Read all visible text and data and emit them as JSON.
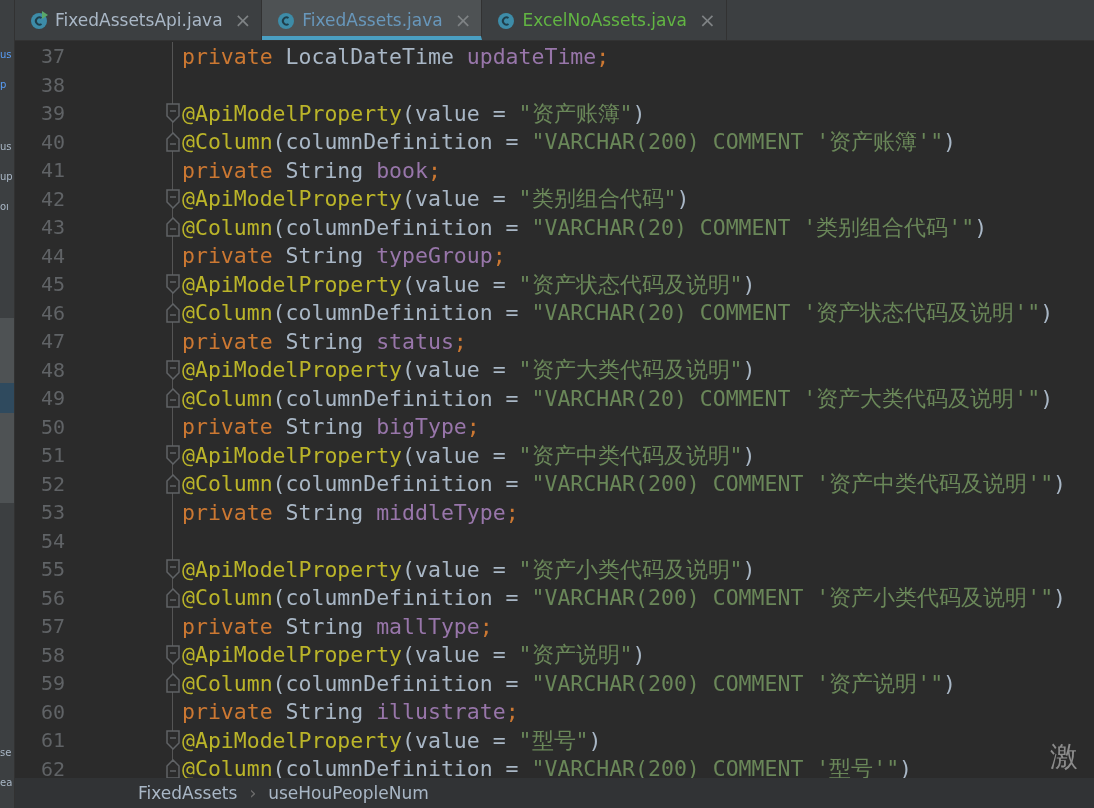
{
  "side_panel": {
    "fragments": [
      {
        "text": "us",
        "kind": "link"
      },
      {
        "text": "p",
        "kind": "link"
      },
      {
        "text": "us",
        "kind": "plain"
      },
      {
        "text": "up",
        "kind": "plain"
      },
      {
        "text": "oı",
        "kind": "plain"
      }
    ],
    "bottom_fragments": [
      {
        "text": "se"
      },
      {
        "text": "ea"
      }
    ]
  },
  "tabs": [
    {
      "label": "FixedAssetsApi.java",
      "close": "×",
      "selected": false,
      "color": "#a9b7c6",
      "runnable": true
    },
    {
      "label": "FixedAssets.java",
      "close": "×",
      "selected": true,
      "color": "#6897bb",
      "runnable": false
    },
    {
      "label": "ExcelNoAssets.java",
      "close": "×",
      "selected": false,
      "color": "#62b543",
      "runnable": false
    }
  ],
  "lines": [
    {
      "number": "37",
      "tokens": [
        {
          "kind": "kw",
          "text": "private "
        },
        {
          "kind": "plain",
          "text": "LocalDateTime "
        },
        {
          "kind": "field",
          "text": "updateTime"
        },
        {
          "kind": "kw",
          "text": ";"
        }
      ]
    },
    {
      "number": "38"
    },
    {
      "number": "39",
      "fold_start": true,
      "tokens": [
        {
          "kind": "ann",
          "text": "@ApiModelProperty"
        },
        {
          "kind": "plain",
          "text": "(value = "
        },
        {
          "kind": "str",
          "text": "\"资产账簿\""
        },
        {
          "kind": "plain",
          "text": ")"
        }
      ]
    },
    {
      "number": "40",
      "fold_end": true,
      "tokens": [
        {
          "kind": "ann",
          "text": "@Column"
        },
        {
          "kind": "plain",
          "text": "(columnDefinition = "
        },
        {
          "kind": "str",
          "text": "\"VARCHAR(200) COMMENT '资产账簿'\""
        },
        {
          "kind": "plain",
          "text": ")"
        }
      ]
    },
    {
      "number": "41",
      "tokens": [
        {
          "kind": "kw",
          "text": "private "
        },
        {
          "kind": "plain",
          "text": "String "
        },
        {
          "kind": "field",
          "text": "book"
        },
        {
          "kind": "kw",
          "text": ";"
        }
      ]
    },
    {
      "number": "42",
      "fold_start": true,
      "tokens": [
        {
          "kind": "ann",
          "text": "@ApiModelProperty"
        },
        {
          "kind": "plain",
          "text": "(value = "
        },
        {
          "kind": "str",
          "text": "\"类别组合代码\""
        },
        {
          "kind": "plain",
          "text": ")"
        }
      ]
    },
    {
      "number": "43",
      "fold_end": true,
      "tokens": [
        {
          "kind": "ann",
          "text": "@Column"
        },
        {
          "kind": "plain",
          "text": "(columnDefinition = "
        },
        {
          "kind": "str",
          "text": "\"VARCHAR(20) COMMENT '类别组合代码'\""
        },
        {
          "kind": "plain",
          "text": ")"
        }
      ]
    },
    {
      "number": "44",
      "tokens": [
        {
          "kind": "kw",
          "text": "private "
        },
        {
          "kind": "plain",
          "text": "String "
        },
        {
          "kind": "field",
          "text": "typeGroup"
        },
        {
          "kind": "kw",
          "text": ";"
        }
      ]
    },
    {
      "number": "45",
      "fold_start": true,
      "tokens": [
        {
          "kind": "ann",
          "text": "@ApiModelProperty"
        },
        {
          "kind": "plain",
          "text": "(value = "
        },
        {
          "kind": "str",
          "text": "\"资产状态代码及说明\""
        },
        {
          "kind": "plain",
          "text": ")"
        }
      ]
    },
    {
      "number": "46",
      "fold_end": true,
      "tokens": [
        {
          "kind": "ann",
          "text": "@Column"
        },
        {
          "kind": "plain",
          "text": "(columnDefinition = "
        },
        {
          "kind": "str",
          "text": "\"VARCHAR(20) COMMENT '资产状态代码及说明'\""
        },
        {
          "kind": "plain",
          "text": ")"
        }
      ]
    },
    {
      "number": "47",
      "tokens": [
        {
          "kind": "kw",
          "text": "private "
        },
        {
          "kind": "plain",
          "text": "String "
        },
        {
          "kind": "field",
          "text": "status"
        },
        {
          "kind": "kw",
          "text": ";"
        }
      ]
    },
    {
      "number": "48",
      "fold_start": true,
      "tokens": [
        {
          "kind": "ann",
          "text": "@ApiModelProperty"
        },
        {
          "kind": "plain",
          "text": "(value = "
        },
        {
          "kind": "str",
          "text": "\"资产大类代码及说明\""
        },
        {
          "kind": "plain",
          "text": ")"
        }
      ]
    },
    {
      "number": "49",
      "fold_end": true,
      "tokens": [
        {
          "kind": "ann",
          "text": "@Column"
        },
        {
          "kind": "plain",
          "text": "(columnDefinition = "
        },
        {
          "kind": "str",
          "text": "\"VARCHAR(20) COMMENT '资产大类代码及说明'\""
        },
        {
          "kind": "plain",
          "text": ")"
        }
      ]
    },
    {
      "number": "50",
      "tokens": [
        {
          "kind": "kw",
          "text": "private "
        },
        {
          "kind": "plain",
          "text": "String "
        },
        {
          "kind": "field",
          "text": "bigType"
        },
        {
          "kind": "kw",
          "text": ";"
        }
      ]
    },
    {
      "number": "51",
      "fold_start": true,
      "tokens": [
        {
          "kind": "ann",
          "text": "@ApiModelProperty"
        },
        {
          "kind": "plain",
          "text": "(value = "
        },
        {
          "kind": "str",
          "text": "\"资产中类代码及说明\""
        },
        {
          "kind": "plain",
          "text": ")"
        }
      ]
    },
    {
      "number": "52",
      "fold_end": true,
      "tokens": [
        {
          "kind": "ann",
          "text": "@Column"
        },
        {
          "kind": "plain",
          "text": "(columnDefinition = "
        },
        {
          "kind": "str",
          "text": "\"VARCHAR(200) COMMENT '资产中类代码及说明'\""
        },
        {
          "kind": "plain",
          "text": ")"
        }
      ]
    },
    {
      "number": "53",
      "tokens": [
        {
          "kind": "kw",
          "text": "private "
        },
        {
          "kind": "plain",
          "text": "String "
        },
        {
          "kind": "field",
          "text": "middleType"
        },
        {
          "kind": "kw",
          "text": ";"
        }
      ]
    },
    {
      "number": "54"
    },
    {
      "number": "55",
      "fold_start": true,
      "tokens": [
        {
          "kind": "ann",
          "text": "@ApiModelProperty"
        },
        {
          "kind": "plain",
          "text": "(value = "
        },
        {
          "kind": "str",
          "text": "\"资产小类代码及说明\""
        },
        {
          "kind": "plain",
          "text": ")"
        }
      ]
    },
    {
      "number": "56",
      "fold_end": true,
      "tokens": [
        {
          "kind": "ann",
          "text": "@Column"
        },
        {
          "kind": "plain",
          "text": "(columnDefinition = "
        },
        {
          "kind": "str",
          "text": "\"VARCHAR(200) COMMENT '资产小类代码及说明'\""
        },
        {
          "kind": "plain",
          "text": ")"
        }
      ]
    },
    {
      "number": "57",
      "tokens": [
        {
          "kind": "kw",
          "text": "private "
        },
        {
          "kind": "plain",
          "text": "String "
        },
        {
          "kind": "field",
          "text": "mallType"
        },
        {
          "kind": "kw",
          "text": ";"
        }
      ]
    },
    {
      "number": "58",
      "fold_start": true,
      "tokens": [
        {
          "kind": "ann",
          "text": "@ApiModelProperty"
        },
        {
          "kind": "plain",
          "text": "(value = "
        },
        {
          "kind": "str",
          "text": "\"资产说明\""
        },
        {
          "kind": "plain",
          "text": ")"
        }
      ]
    },
    {
      "number": "59",
      "fold_end": true,
      "tokens": [
        {
          "kind": "ann",
          "text": "@Column"
        },
        {
          "kind": "plain",
          "text": "(columnDefinition = "
        },
        {
          "kind": "str",
          "text": "\"VARCHAR(200) COMMENT '资产说明'\""
        },
        {
          "kind": "plain",
          "text": ")"
        }
      ]
    },
    {
      "number": "60",
      "tokens": [
        {
          "kind": "kw",
          "text": "private "
        },
        {
          "kind": "plain",
          "text": "String "
        },
        {
          "kind": "field",
          "text": "illustrate"
        },
        {
          "kind": "kw",
          "text": ";"
        }
      ]
    },
    {
      "number": "61",
      "fold_start": true,
      "tokens": [
        {
          "kind": "ann",
          "text": "@ApiModelProperty"
        },
        {
          "kind": "plain",
          "text": "(value = "
        },
        {
          "kind": "str",
          "text": "\"型号\""
        },
        {
          "kind": "plain",
          "text": ")"
        }
      ]
    },
    {
      "number": "62",
      "fold_end": true,
      "tokens": [
        {
          "kind": "ann",
          "text": "@Column"
        },
        {
          "kind": "plain",
          "text": "(columnDefinition = "
        },
        {
          "kind": "str",
          "text": "\"VARCHAR(200) COMMENT '型号'\""
        },
        {
          "kind": "plain",
          "text": ")"
        }
      ]
    }
  ],
  "breadcrumb": [
    {
      "text": "FixedAssets"
    },
    {
      "text": "useHouPeopleNum"
    }
  ],
  "breadcrumb_separator": "›",
  "overlay_text": "激"
}
